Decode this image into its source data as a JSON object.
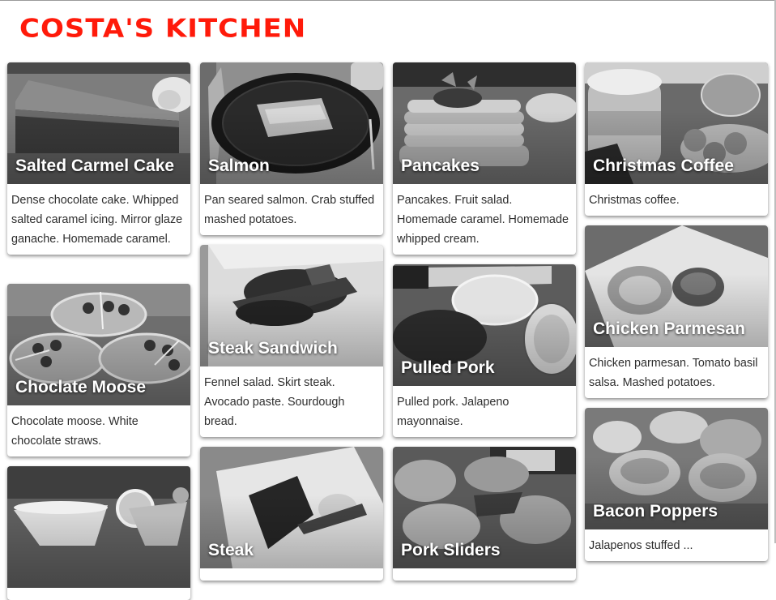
{
  "site": {
    "title": "COSTA'S KITCHEN"
  },
  "cards": [
    {
      "title": "Salted Carmel Cake",
      "description": "Dense chocolate cake. Whipped salted caramel icing. Mirror glaze ganache. Homemade caramel.",
      "photo_icon": "cake-slice"
    },
    {
      "title": "Salmon",
      "description": "Pan seared salmon. Crab stuffed mashed potatoes.",
      "photo_icon": "plate-with-salmon"
    },
    {
      "title": "Pancakes",
      "description": "Pancakes. Fruit salad. Homemade caramel. Homemade whipped cream.",
      "photo_icon": "pancake-stack"
    },
    {
      "title": "Christmas Coffee",
      "description": "Christmas coffee.",
      "photo_icon": "coffee-glass"
    },
    {
      "title": "Choclate Moose",
      "description": "Chocolate moose. White chocolate straws.",
      "photo_icon": "mousse-cups"
    },
    {
      "title": "Steak Sandwich",
      "description": "Fennel salad. Skirt steak. Avocado paste. Sourdough bread.",
      "photo_icon": "sandwich-plate"
    },
    {
      "title": "Pulled Pork",
      "description": "Pulled pork. Jalapeno mayonnaise.",
      "photo_icon": "pulled-pork-board"
    },
    {
      "title": "Chicken Parmesan",
      "description": "Chicken parmesan. Tomato basil salsa. Mashed potatoes.",
      "photo_icon": "chicken-parmesan-plate"
    },
    {
      "title": "",
      "description": "",
      "photo_icon": "margarita-glasses"
    },
    {
      "title": "Steak",
      "description": "",
      "photo_icon": "steak-plate"
    },
    {
      "title": "Pork Sliders",
      "description": "",
      "photo_icon": "sliders"
    },
    {
      "title": "Bacon Poppers",
      "description": "Jalapenos stuffed ...",
      "photo_icon": "bacon-poppers"
    }
  ]
}
